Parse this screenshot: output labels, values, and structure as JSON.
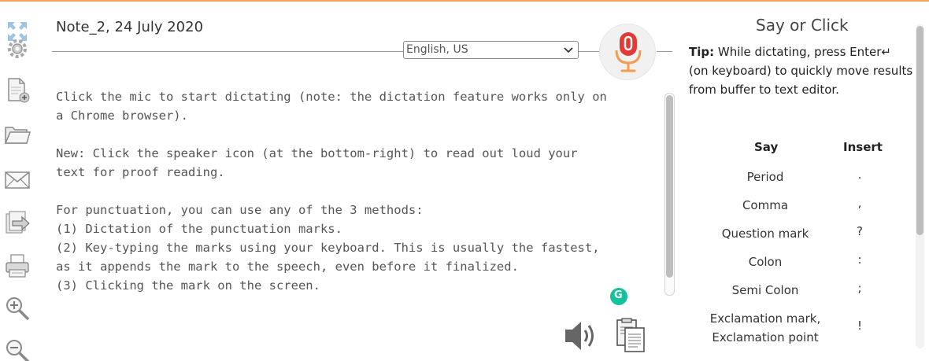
{
  "note": {
    "title": "Note_2, 24 July 2020"
  },
  "language": {
    "selected": "English, US"
  },
  "editor": {
    "text": "Click the mic to start dictating (note: the dictation feature works only on\na Chrome browser).\n\nNew: Click the speaker icon (at the bottom-right) to read out loud your\ntext for proof reading.\n\nFor punctuation, you can use any of the 3 methods:\n(1) Dictation of the punctuation marks.\n(2) Key-typing the marks using your keyboard. This is usually the fastest,\nas it appends the mark to the speech, even before it finalized.\n(3) Clicking the mark on the screen."
  },
  "panel": {
    "title": "Say or Click",
    "tip_label": "Tip:",
    "tip_text": " While dictating, press Enter↵ (on keyboard) to quickly move results from buffer to text editor.",
    "col_say": "Say",
    "col_insert": "Insert",
    "rows": [
      {
        "say": "Period",
        "insert": "."
      },
      {
        "say": "Comma",
        "insert": ","
      },
      {
        "say": "Question mark",
        "insert": "?"
      },
      {
        "say": "Colon",
        "insert": ":"
      },
      {
        "say": "Semi Colon",
        "insert": ";"
      },
      {
        "say": "Exclamation mark,\nExclamation point",
        "insert": "!"
      }
    ]
  },
  "grammarly": {
    "badge": "G"
  },
  "icons": {
    "toolbar": [
      "expand-icon",
      "settings-icon",
      "new-document-icon",
      "open-folder-icon",
      "email-icon",
      "export-icon",
      "print-icon",
      "zoom-in-icon",
      "zoom-out-icon"
    ],
    "mic": "microphone-icon",
    "speaker": "speaker-icon",
    "copy": "clipboard-icon"
  },
  "colors": {
    "accent": "#f5a25d",
    "mic_red": "#e53935",
    "mic_orange": "#f39c4b",
    "grammarly": "#15c39a"
  }
}
